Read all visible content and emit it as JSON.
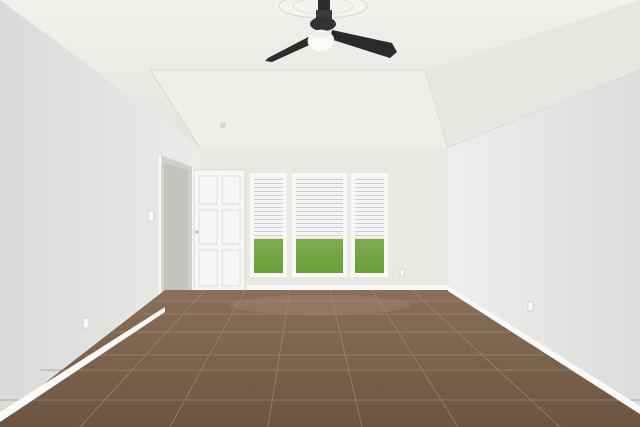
{
  "scene": {
    "subject": "empty-room",
    "features": [
      "ceiling-fan",
      "triple-window-with-blinds",
      "open-door",
      "tile-floor",
      "white-baseboards",
      "wall-outlets",
      "light-switch"
    ],
    "colors": {
      "ceiling": "#ecebe8",
      "left_wall": "#e4e4e2",
      "back_wall": "#e8e8e5",
      "right_wall": "#e6e6e3",
      "baseboard": "#fafafa",
      "floor": "#7e6550",
      "floor_dark": "#5f4a39",
      "grout": "#9b8a7b",
      "window_frame": "#f7f7f7",
      "lawn": "#7fb24d",
      "blinds": "#f2f2f0",
      "fan_blade": "#2a2a2a",
      "fan_light": "#fbfaf3"
    },
    "window_count": 3
  }
}
